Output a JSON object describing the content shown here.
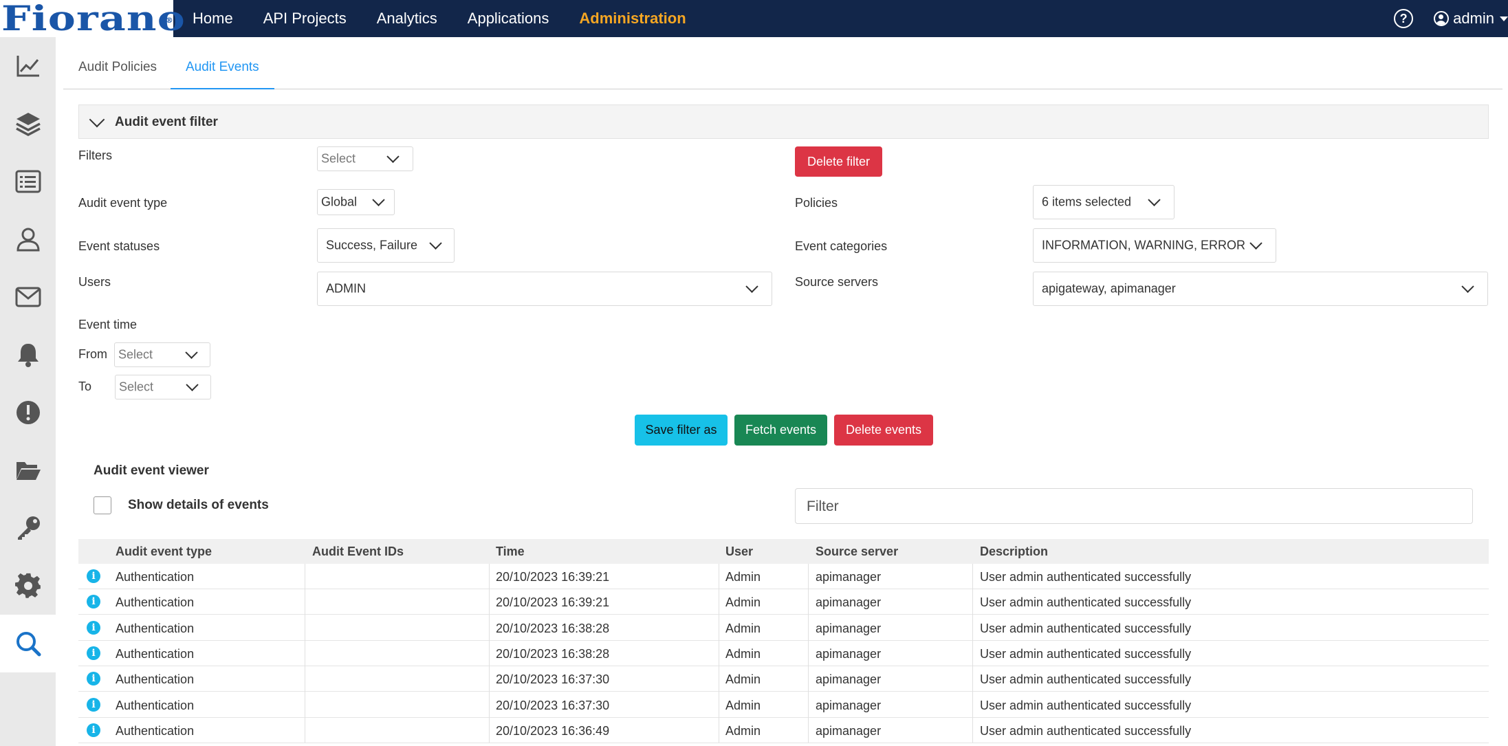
{
  "brand": {
    "logo_text": "Fiorano",
    "logo_mark": "®"
  },
  "nav": {
    "items": [
      {
        "label": "Home",
        "active": false
      },
      {
        "label": "API Projects",
        "active": false
      },
      {
        "label": "Analytics",
        "active": false
      },
      {
        "label": "Applications",
        "active": false
      },
      {
        "label": "Administration",
        "active": true
      }
    ],
    "help_glyph": "?",
    "user_label": "admin"
  },
  "sidebar": {
    "items": [
      {
        "icon": "chart-line-icon",
        "active": false
      },
      {
        "icon": "layers-icon",
        "active": false
      },
      {
        "icon": "list-icon",
        "active": false
      },
      {
        "icon": "user-icon",
        "active": false
      },
      {
        "icon": "mail-icon",
        "active": false
      },
      {
        "icon": "bell-icon",
        "active": false
      },
      {
        "icon": "alert-icon",
        "active": false
      },
      {
        "icon": "folder-icon",
        "active": false
      },
      {
        "icon": "key-icon",
        "active": false
      },
      {
        "icon": "gear-icon",
        "active": false
      },
      {
        "icon": "search-icon",
        "active": true
      }
    ]
  },
  "tabs": {
    "audit_policies": "Audit Policies",
    "audit_events": "Audit Events",
    "active": "Audit Events"
  },
  "filter": {
    "header": "Audit event filter",
    "filters_label": "Filters",
    "filters_value": "Select",
    "delete_filter": "Delete filter",
    "event_type_label": "Audit event type",
    "event_type_value": "Global",
    "policies_label": "Policies",
    "policies_value": "6 items selected",
    "statuses_label": "Event statuses",
    "statuses_value": "Success, Failure",
    "categories_label": "Event categories",
    "categories_value": "INFORMATION, WARNING, ERROR",
    "users_label": "Users",
    "users_value": "ADMIN",
    "servers_label": "Source servers",
    "servers_value": "apigateway, apimanager",
    "event_time_label": "Event time",
    "from_label": "From",
    "from_value": "Select",
    "to_label": "To",
    "to_value": "Select",
    "save_filter": "Save filter as",
    "fetch_events": "Fetch events",
    "delete_events": "Delete events"
  },
  "viewer": {
    "title": "Audit event viewer",
    "show_details": "Show details of events",
    "show_details_checked": false,
    "filter_placeholder": "Filter",
    "columns": [
      "Audit event type",
      "Audit Event IDs",
      "Time",
      "User",
      "Source server",
      "Description"
    ],
    "rows": [
      {
        "type": "Authentication",
        "ids": "",
        "time": "20/10/2023 16:39:21",
        "user": "Admin",
        "server": "apimanager",
        "description": "User admin authenticated successfully"
      },
      {
        "type": "Authentication",
        "ids": "",
        "time": "20/10/2023 16:39:21",
        "user": "Admin",
        "server": "apimanager",
        "description": "User admin authenticated successfully"
      },
      {
        "type": "Authentication",
        "ids": "",
        "time": "20/10/2023 16:38:28",
        "user": "Admin",
        "server": "apimanager",
        "description": "User admin authenticated successfully"
      },
      {
        "type": "Authentication",
        "ids": "",
        "time": "20/10/2023 16:38:28",
        "user": "Admin",
        "server": "apimanager",
        "description": "User admin authenticated successfully"
      },
      {
        "type": "Authentication",
        "ids": "",
        "time": "20/10/2023 16:37:30",
        "user": "Admin",
        "server": "apimanager",
        "description": "User admin authenticated successfully"
      },
      {
        "type": "Authentication",
        "ids": "",
        "time": "20/10/2023 16:37:30",
        "user": "Admin",
        "server": "apimanager",
        "description": "User admin authenticated successfully"
      },
      {
        "type": "Authentication",
        "ids": "",
        "time": "20/10/2023 16:36:49",
        "user": "Admin",
        "server": "apimanager",
        "description": "User admin authenticated successfully"
      }
    ],
    "row_icon_glyph": "i"
  },
  "colors": {
    "topbar": "#12264a",
    "nav_active": "#f5a623",
    "tab_active": "#2196f3",
    "danger": "#dc3545",
    "info": "#17c1e8",
    "success": "#198754"
  }
}
